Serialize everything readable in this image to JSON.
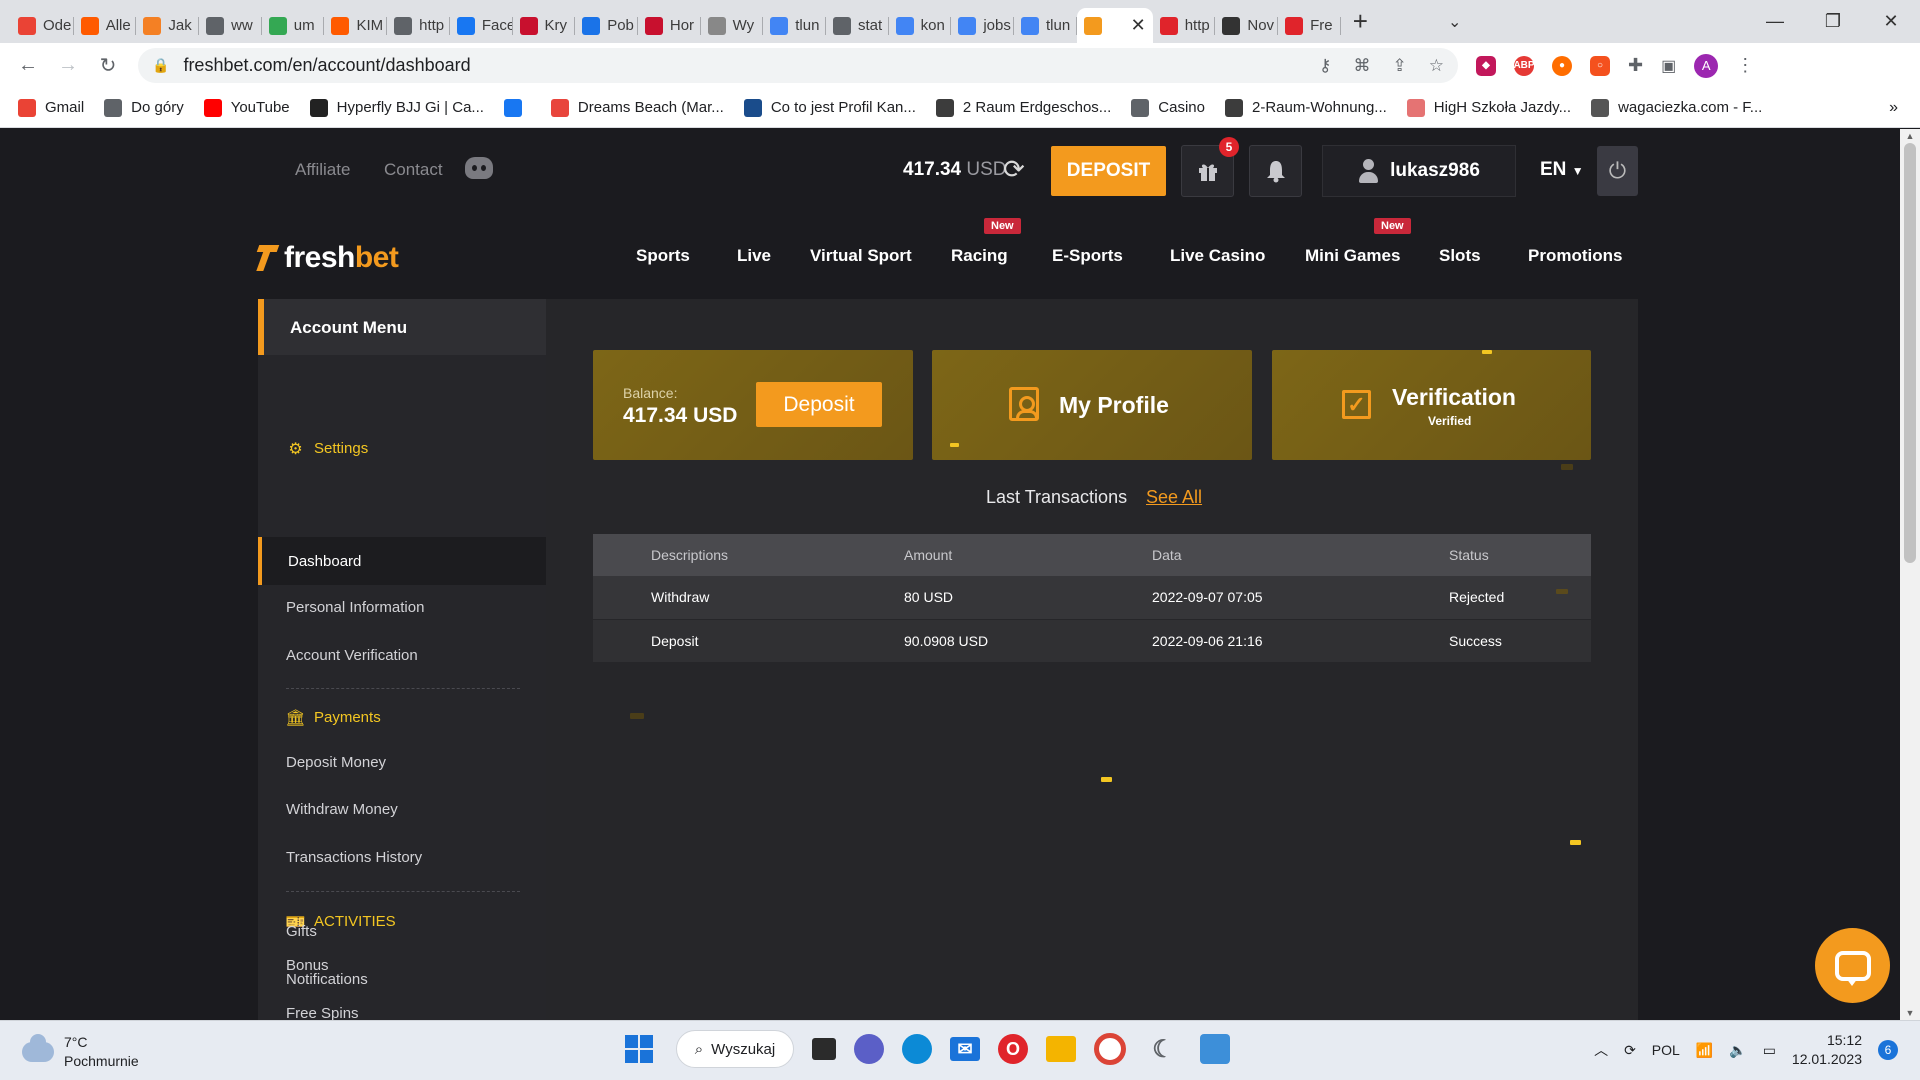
{
  "browser": {
    "tabs": [
      {
        "title": "Ode",
        "favicon": "gmail-icon",
        "color": "#ea4335"
      },
      {
        "title": "Alle",
        "favicon": "allegro-icon",
        "color": "#ff5a00"
      },
      {
        "title": "Jak",
        "favicon": "stack-icon",
        "color": "#f48024"
      },
      {
        "title": "ww",
        "favicon": "globe-icon",
        "color": "#5f6368"
      },
      {
        "title": "um",
        "favicon": "doc-icon",
        "color": "#34a853"
      },
      {
        "title": "KIM",
        "favicon": "allegro-icon",
        "color": "#ff5a00"
      },
      {
        "title": "http",
        "favicon": "globe-icon",
        "color": "#5f6368"
      },
      {
        "title": "Face",
        "favicon": "facebook-icon",
        "color": "#1877f2"
      },
      {
        "title": "Kry",
        "favicon": "grid-icon",
        "color": "#c8102e"
      },
      {
        "title": "Pob",
        "favicon": "download-icon",
        "color": "#1a73e8"
      },
      {
        "title": "Hor",
        "favicon": "grid-icon",
        "color": "#c8102e"
      },
      {
        "title": "Wy",
        "favicon": "s-icon",
        "color": "#888888"
      },
      {
        "title": "tlun",
        "favicon": "google-icon",
        "color": "#4285f4"
      },
      {
        "title": "stat",
        "favicon": "globe-icon",
        "color": "#5f6368"
      },
      {
        "title": "kon",
        "favicon": "google-icon",
        "color": "#4285f4"
      },
      {
        "title": "jobs",
        "favicon": "google-icon",
        "color": "#4285f4"
      },
      {
        "title": "tlun",
        "favicon": "google-icon",
        "color": "#4285f4"
      },
      {
        "title": "",
        "favicon": "freshbet-icon",
        "color": "#f39a1e",
        "active": true
      },
      {
        "title": "http",
        "favicon": "pdf-icon",
        "color": "#e0242b"
      },
      {
        "title": "Nov",
        "favicon": "github-icon",
        "color": "#333333"
      },
      {
        "title": "Fre",
        "favicon": "pdf-icon",
        "color": "#e0242b"
      }
    ],
    "url": "freshbet.com/en/account/dashboard",
    "bookmarks": [
      {
        "label": "Gmail",
        "icon": "gmail-icon",
        "color": "#ea4335"
      },
      {
        "label": "Do góry",
        "icon": "globe-icon",
        "color": "#5f6368"
      },
      {
        "label": "YouTube",
        "icon": "youtube-icon",
        "color": "#ff0000"
      },
      {
        "label": "Hyperfly BJJ Gi | Ca...",
        "icon": "hyperfly-icon",
        "color": "#222222"
      },
      {
        "label": "",
        "icon": "facebook-icon",
        "color": "#1877f2"
      },
      {
        "label": "Dreams Beach (Mar...",
        "icon": "pin-icon",
        "color": "#e8453c"
      },
      {
        "label": "Co to jest Profil Kan...",
        "icon": "bird-icon",
        "color": "#1a4c8b"
      },
      {
        "label": "2 Raum Erdgeschos...",
        "icon": "immo-icon",
        "color": "#3c3c3c"
      },
      {
        "label": "Casino",
        "icon": "globe-icon",
        "color": "#5f6368"
      },
      {
        "label": "2-Raum-Wohnung...",
        "icon": "immo-icon",
        "color": "#3c3c3c"
      },
      {
        "label": "HigH Szkoła Jazdy...",
        "icon": "pig-icon",
        "color": "#e57373"
      },
      {
        "label": "wagaciezka.com - F...",
        "icon": "scale-icon",
        "color": "#555555"
      }
    ],
    "bookmarks_more": "»"
  },
  "site": {
    "top_links": {
      "affiliate": "Affiliate",
      "contact": "Contact"
    },
    "balance_amount": "417.34",
    "balance_currency": "USD",
    "deposit_button": "DEPOSIT",
    "gift_badge": "5",
    "username": "lukasz986",
    "language": "EN",
    "logo": {
      "fresh": "fresh",
      "bet": "bet"
    },
    "nav": [
      {
        "label": "Sports"
      },
      {
        "label": "Live"
      },
      {
        "label": "Virtual Sport"
      },
      {
        "label": "Racing",
        "tag": "New"
      },
      {
        "label": "E-Sports"
      },
      {
        "label": "Live Casino"
      },
      {
        "label": "Mini Games",
        "tag": "New"
      },
      {
        "label": "Slots"
      },
      {
        "label": "Promotions"
      }
    ],
    "sidebar": {
      "header": "Account Menu",
      "settings_title": "Settings",
      "settings_items": [
        "Dashboard",
        "Personal Information",
        "Account Verification"
      ],
      "payments_title": "Payments",
      "payments_items": [
        "Deposit Money",
        "Withdraw Money",
        "Transactions History"
      ],
      "activities_title": "ACTIVITIES",
      "activities_items": [
        "Bonus",
        "Free Spins",
        "Gifts",
        "Notifications"
      ]
    },
    "cards": {
      "balance_label": "Balance:",
      "balance_value": "417.34 USD",
      "deposit_label": "Deposit",
      "profile_title": "My Profile",
      "verification_title": "Verification",
      "verification_status": "Verified"
    },
    "transactions": {
      "title": "Last Transactions",
      "see_all": "See All",
      "headers": [
        "Descriptions",
        "Amount",
        "Data",
        "Status"
      ],
      "rows": [
        [
          "Withdraw",
          "80 USD",
          "2022-09-07 07:05",
          "Rejected"
        ],
        [
          "Deposit",
          "90.0908 USD",
          "2022-09-06 21:16",
          "Success"
        ]
      ]
    },
    "colors": {
      "accent": "#f39a1e",
      "highlight": "#f3c622",
      "card": "#7d6617",
      "background": "#1b1b1f"
    }
  },
  "taskbar": {
    "weather_temp": "7°C",
    "weather_desc": "Pochmurnie",
    "search_label": "Wyszukaj",
    "language": "POL",
    "time": "15:12",
    "date": "12.01.2023",
    "notifications": "6"
  }
}
